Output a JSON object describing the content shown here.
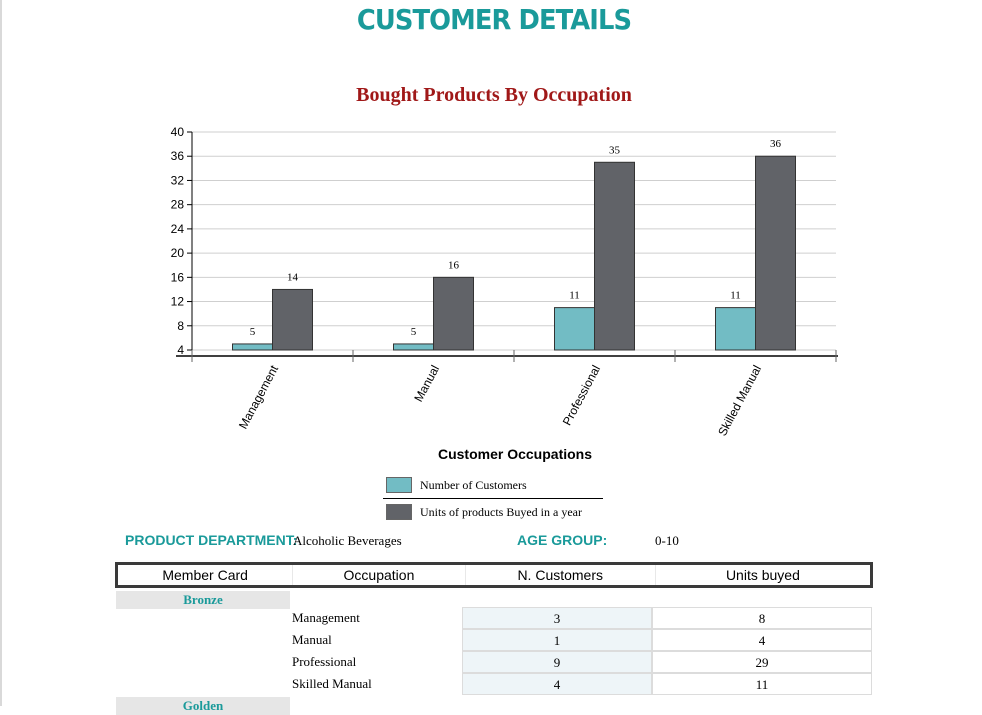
{
  "page": {
    "title": "CUSTOMER DETAILS"
  },
  "chart_data": {
    "type": "bar",
    "title": "Bought Products By Occupation",
    "xlabel": "Customer Occupations",
    "ylabel": "",
    "ylim": [
      4,
      40
    ],
    "yticks": [
      4,
      8,
      12,
      16,
      20,
      24,
      28,
      32,
      36,
      40
    ],
    "categories": [
      "Management",
      "Manual",
      "Professional",
      "Skilled Manual"
    ],
    "series": [
      {
        "name": "Number of Customers",
        "values": [
          5,
          5,
          11,
          11
        ],
        "color": "#72bcc4"
      },
      {
        "name": "Units of products Buyed in a year",
        "values": [
          14,
          16,
          35,
          36
        ],
        "color": "#616368"
      }
    ],
    "grid": true,
    "legend_position": "bottom"
  },
  "filters": {
    "department_label": "PRODUCT DEPARTMENT:",
    "department_value": "Alcoholic Beverages",
    "age_label": "AGE GROUP:",
    "age_value": "0-10"
  },
  "table": {
    "headers": [
      "Member Card",
      "Occupation",
      "N. Customers",
      "Units buyed"
    ],
    "groups": [
      {
        "label": "Bronze",
        "rows": [
          {
            "occupation": "Management",
            "customers": "3",
            "units": "8"
          },
          {
            "occupation": "Manual",
            "customers": "1",
            "units": "4"
          },
          {
            "occupation": "Professional",
            "customers": "9",
            "units": "29"
          },
          {
            "occupation": "Skilled Manual",
            "customers": "4",
            "units": "11"
          }
        ]
      },
      {
        "label": "Golden",
        "rows": []
      }
    ]
  }
}
